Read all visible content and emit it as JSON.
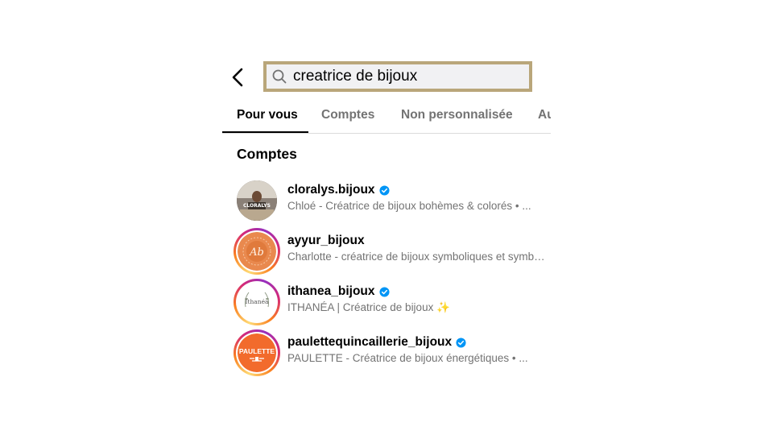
{
  "search": {
    "value": "creatrice de bijoux"
  },
  "tabs": [
    {
      "label": "Pour vous",
      "active": true
    },
    {
      "label": "Comptes",
      "active": false
    },
    {
      "label": "Non personnalisée",
      "active": false
    },
    {
      "label": "Au",
      "active": false
    }
  ],
  "section_title": "Comptes",
  "accounts": [
    {
      "username": "cloralys.bijoux",
      "verified": true,
      "description": "Chloé - Créatrice de bijoux bohèmes & colorés • ...",
      "avatar_text": "CLORALYS",
      "has_story": false
    },
    {
      "username": "ayyur_bijoux",
      "verified": false,
      "description": "Charlotte - créatrice de bijoux symboliques et symboliques",
      "avatar_text": "Ab",
      "has_story": true
    },
    {
      "username": "ithanea_bijoux",
      "verified": true,
      "description": "ITHANÉA | Créatrice de bijoux ✨",
      "avatar_text": "Ithanéa",
      "has_story": true
    },
    {
      "username": "paulettequincaillerie_bijoux",
      "verified": true,
      "description": "PAULETTE - Créatrice de bijoux énergétiques • ...",
      "avatar_text": "PAULETTE",
      "has_story": true
    }
  ],
  "colors": {
    "accent_verified": "#0095f6",
    "search_border": "#b9a67a",
    "secondary_text": "#737373",
    "orange_brand": "#f26b2c"
  },
  "icons": {
    "back": "chevron-left-icon",
    "search": "search-icon",
    "verified": "verified-badge-icon"
  }
}
